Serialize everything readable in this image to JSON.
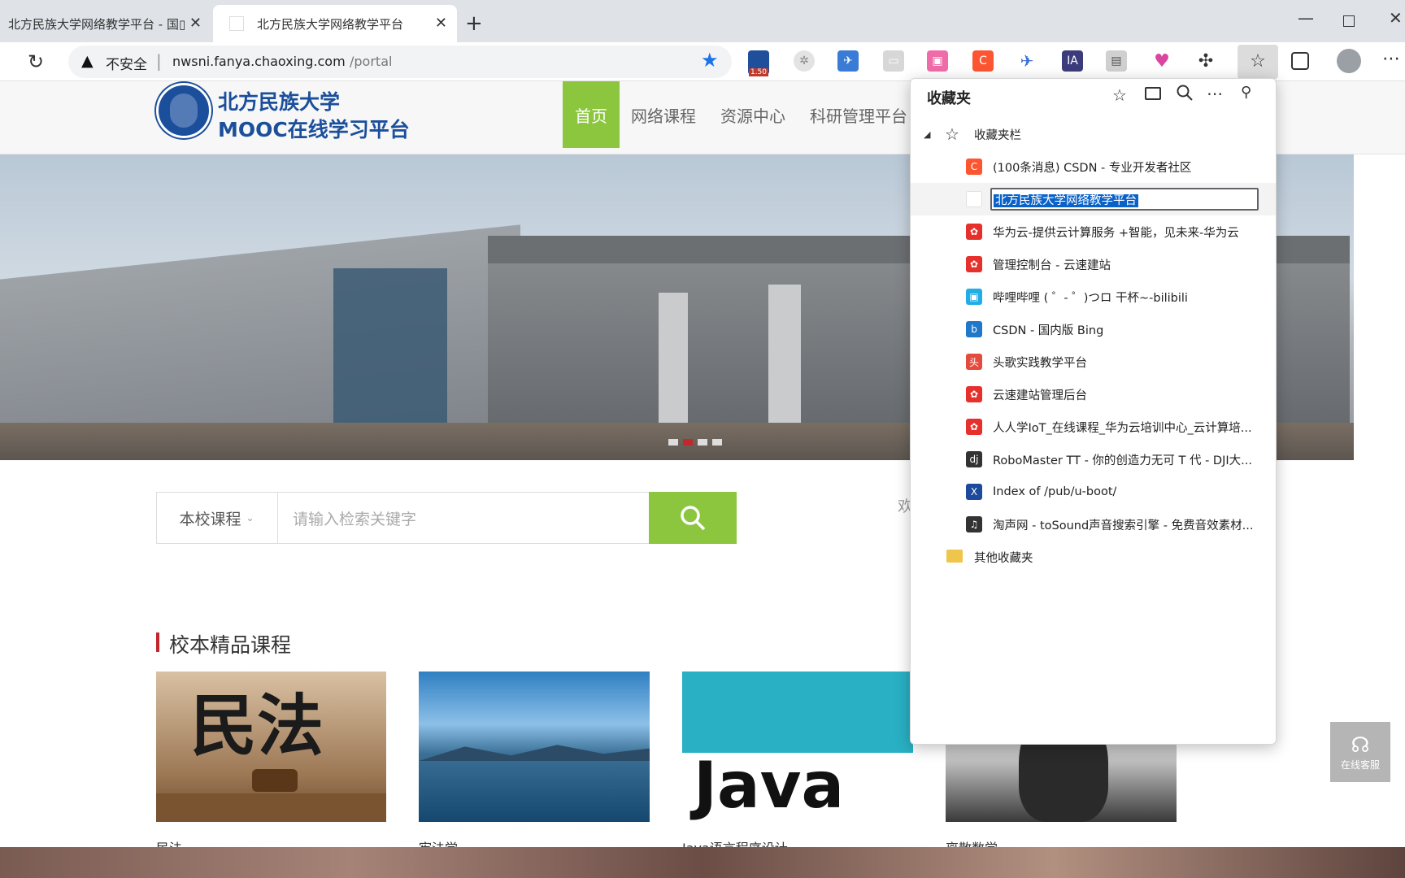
{
  "browser": {
    "tabs": [
      {
        "label": "北方民族大学网络教学平台 - 国▯"
      },
      {
        "label": "北方民族大学网络教学平台"
      }
    ],
    "new_tab": "+",
    "security_label": "不安全",
    "url_host": "nwsni.fanya.chaoxing.com",
    "url_path": "/portal",
    "ext_badge": "1.50"
  },
  "site": {
    "logo_line1": "北方民族大学",
    "logo_line2": "MOOC在线学习平台",
    "nav": [
      "首页",
      "网络课程",
      "资源中心",
      "科研管理平台"
    ],
    "search_scope": "本校课程",
    "search_placeholder": "请输入检索关键字",
    "welcome_partial": "欢",
    "section_title": "校本精品课程",
    "courses": [
      {
        "title": "民法",
        "cover_text": "民法"
      },
      {
        "title": "宪法学",
        "cover_text": ""
      },
      {
        "title": "Java语言程序设计",
        "cover_text": "Java"
      },
      {
        "title": "离散数学",
        "cover_text": ""
      }
    ],
    "online_service": "在线客服"
  },
  "favorites": {
    "title": "收藏夹",
    "bar_label": "收藏夹栏",
    "items": [
      {
        "label": "(100条消息) CSDN - 专业开发者社区",
        "icon": "csdn-icon",
        "color": "#fc5531",
        "glyph": "C"
      },
      {
        "label": "北方民族大学网络教学平台",
        "icon": "blank-page-icon",
        "color": "#ffffff",
        "glyph": "",
        "editing": true
      },
      {
        "label": "华为云-提供云计算服务 +智能，见未来-华为云",
        "icon": "huawei-icon",
        "color": "#e6302c",
        "glyph": "✿"
      },
      {
        "label": "管理控制台 - 云速建站",
        "icon": "huawei-icon",
        "color": "#e6302c",
        "glyph": "✿"
      },
      {
        "label": "哔哩哔哩 ( ゜- ゜)つロ 干杯~-bilibili",
        "icon": "bilibili-icon",
        "color": "#23ade5",
        "glyph": "▣"
      },
      {
        "label": "CSDN - 国内版 Bing",
        "icon": "bing-icon",
        "color": "#1f78c8",
        "glyph": "b"
      },
      {
        "label": "头歌实践教学平台",
        "icon": "educoder-icon",
        "color": "#e54b3c",
        "glyph": "头"
      },
      {
        "label": "云速建站管理后台",
        "icon": "huawei-icon",
        "color": "#e6302c",
        "glyph": "✿"
      },
      {
        "label": "人人学IoT_在线课程_华为云培训中心_云计算培...",
        "icon": "huawei-icon",
        "color": "#e6302c",
        "glyph": "✿"
      },
      {
        "label": "RoboMaster TT - 你的创造力无可 T 代 - DJI大...",
        "icon": "dji-icon",
        "color": "#333333",
        "glyph": "dj"
      },
      {
        "label": "Index of /pub/u-boot/",
        "icon": "x-icon",
        "color": "#1d4a9c",
        "glyph": "X"
      },
      {
        "label": "淘声网 - toSound声音搜索引擎 - 免费音效素材...",
        "icon": "headphones-icon",
        "color": "#333333",
        "glyph": "♫"
      }
    ],
    "other_folder": "其他收藏夹"
  }
}
